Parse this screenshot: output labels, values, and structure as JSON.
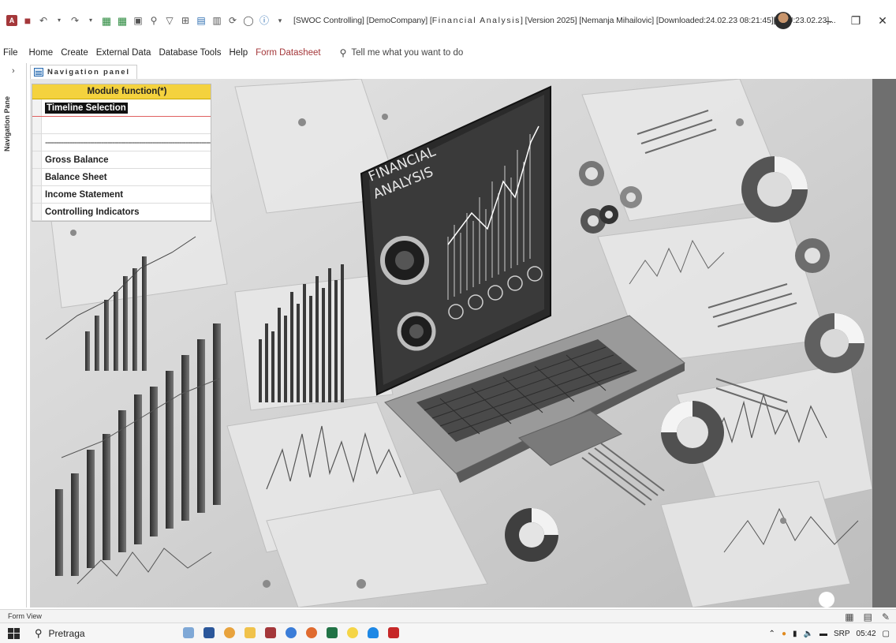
{
  "titlebar": {
    "title_prefix": "[SWOC Controlling] [DemoCompany] [",
    "title_spaced": "Financial Analysis",
    "title_suffix": "] [Version 2025] [Nemanja Mihailovic] [Downloaded:24.02.23 08:21:45][DPU:23.02.23]...",
    "minimize": "–",
    "restore": "❐",
    "close": "✕"
  },
  "menu": {
    "items": [
      "File",
      "Home",
      "Create",
      "External Data",
      "Database Tools",
      "Help",
      "Form Datasheet"
    ],
    "tell_me": "Tell me what you want to do"
  },
  "navpane": {
    "label": "Navigation Pane",
    "chevron": "›"
  },
  "doctab": {
    "label": "Navigation panel"
  },
  "module_list": {
    "header": "Module function(*)",
    "rows": [
      {
        "label": "Timeline Selection",
        "selected": true
      },
      {
        "label": ""
      },
      {
        "label": "--------------------------------------------------------------------------"
      },
      {
        "label": "Gross Balance"
      },
      {
        "label": "Balance Sheet"
      },
      {
        "label": "Income Statement"
      },
      {
        "label": "Controlling Indicators"
      }
    ]
  },
  "illustration": {
    "screen_title_line1": "FINANCIAL",
    "screen_title_line2": "ANALYSIS"
  },
  "statusbar": {
    "left": "Form View"
  },
  "taskbar": {
    "search": "Pretraga",
    "language": "SRP",
    "time": "05:42"
  },
  "icons": {
    "access": "access-icon",
    "save": "save-icon",
    "undo": "undo-icon",
    "redo": "redo-icon",
    "search": "search-icon",
    "filter": "filter-icon",
    "info": "info-icon"
  }
}
